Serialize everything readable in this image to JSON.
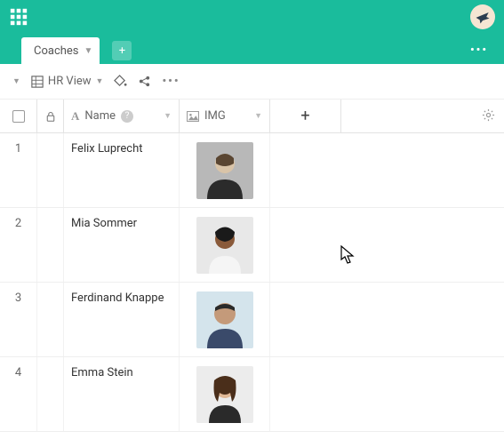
{
  "colors": {
    "accent": "#1abc9c"
  },
  "header": {
    "apps_icon": "apps-grid",
    "avatar_icon": "bird"
  },
  "tabs": {
    "active": "Coaches",
    "add_label": "+",
    "more_label": "•••"
  },
  "toolbar": {
    "collapse_icon": "caret-down",
    "view_label": "HR View",
    "paint_icon": "paint-bucket",
    "share_icon": "share",
    "more_label": "•••"
  },
  "columns": {
    "checkbox": "",
    "lock_icon": "lock",
    "name_label": "Name",
    "name_type_icon": "text-A",
    "name_help_icon": "?",
    "img_label": "IMG",
    "img_type_icon": "image",
    "add_label": "+",
    "settings_icon": "gear"
  },
  "rows": [
    {
      "n": "1",
      "name": "Felix Luprecht",
      "img": "person-1"
    },
    {
      "n": "2",
      "name": "Mia Sommer",
      "img": "person-2"
    },
    {
      "n": "3",
      "name": "Ferdinand Knappe",
      "img": "person-3"
    },
    {
      "n": "4",
      "name": "Emma Stein",
      "img": "person-4"
    }
  ]
}
